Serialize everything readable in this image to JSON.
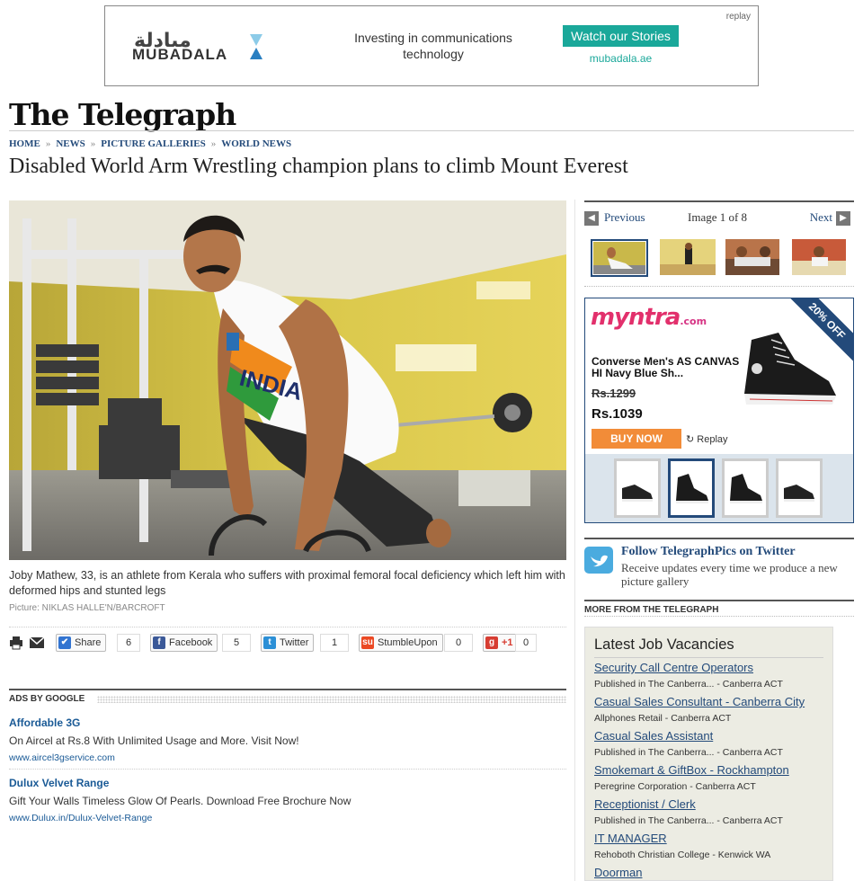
{
  "top_ad": {
    "brand_ar": "مبادلة",
    "brand_en": "MUBADALA",
    "tagline": "Investing in communications technology",
    "cta": "Watch our Stories",
    "site": "mubadala.ae",
    "replay": "replay",
    "colors": {
      "accent": "#1aa89a",
      "hourglass": "#2a7fc1"
    }
  },
  "masthead": "The Telegraph",
  "breadcrumb": [
    "HOME",
    "NEWS",
    "PICTURE GALLERIES",
    "WORLD NEWS"
  ],
  "headline": "Disabled World Arm Wrestling champion plans to climb Mount Everest",
  "photo": {
    "caption": "Joby Mathew, 33, is an athlete from Kerala who suffers with proximal femoral focal deficiency which left him with deformed hips and stunted legs",
    "credit": "Picture: NIKLAS HALLE'N/BARCROFT",
    "shirt_text": "INDIA"
  },
  "share": {
    "print_icon": "printer-icon",
    "email_icon": "envelope-icon",
    "buttons": [
      {
        "label": "Share",
        "count": "6",
        "icon": "delicious-icon",
        "color": "#3274d1"
      },
      {
        "label": "Facebook",
        "count": "5",
        "icon": "facebook-icon",
        "color": "#3b5998"
      },
      {
        "label": "Twitter",
        "count": "1",
        "icon": "twitter-icon",
        "color": "#2b8fd6"
      },
      {
        "label": "StumbleUpon",
        "count": "0",
        "icon": "stumbleupon-icon",
        "color": "#eb4924"
      },
      {
        "label": "+1",
        "count": "0",
        "icon": "google-plus-icon",
        "color": "#d73d32"
      }
    ]
  },
  "google_ads": {
    "heading": "ADS BY GOOGLE",
    "ads": [
      {
        "title": "Affordable 3G",
        "desc": "On Aircel at Rs.8 With Unlimited Usage and More. Visit Now!",
        "url": "www.aircel3gservice.com"
      },
      {
        "title": "Dulux Velvet Range",
        "desc": "Gift Your Walls Timeless Glow Of Pearls. Download Free Brochure Now",
        "url": "www.Dulux.in/Dulux-Velvet-Range"
      }
    ]
  },
  "gallery": {
    "previous": "Previous",
    "count": "Image 1 of 8",
    "next": "Next",
    "selected_thumb": 0
  },
  "myntra_ad": {
    "brand": "myntra",
    "brand_suffix": ".com",
    "ribbon": "20% OFF",
    "product": "Converse Men's AS CANVAS HI Navy Blue Sh...",
    "old_price": "Rs.1299",
    "new_price": "Rs.1039",
    "buy": "BUY NOW",
    "replay": "Replay",
    "selected_swatch": 1,
    "colors": {
      "buy": "#f28c38",
      "border": "#234a7a"
    }
  },
  "twitter_promo": {
    "heading": "Follow TelegraphPics on Twitter",
    "text": "Receive updates every time we produce a new picture gallery"
  },
  "more_heading": "MORE FROM THE TELEGRAPH",
  "jobs": {
    "heading": "Latest Job Vacancies",
    "items": [
      {
        "title": "Security Call Centre Operators",
        "meta": "Published in The Canberra... - Canberra ACT"
      },
      {
        "title": "Casual Sales Consultant - Canberra City",
        "meta": "Allphones Retail - Canberra ACT"
      },
      {
        "title": "Casual Sales Assistant",
        "meta": "Published in The Canberra... - Canberra ACT"
      },
      {
        "title": "Smokemart & GiftBox - Rockhampton",
        "meta": "Peregrine Corporation - Canberra ACT"
      },
      {
        "title": "Receptionist / Clerk",
        "meta": "Published in The Canberra... - Canberra ACT"
      },
      {
        "title": "IT MANAGER",
        "meta": "Rehoboth Christian College - Kenwick WA"
      },
      {
        "title": "Doorman",
        "meta": ""
      }
    ]
  }
}
